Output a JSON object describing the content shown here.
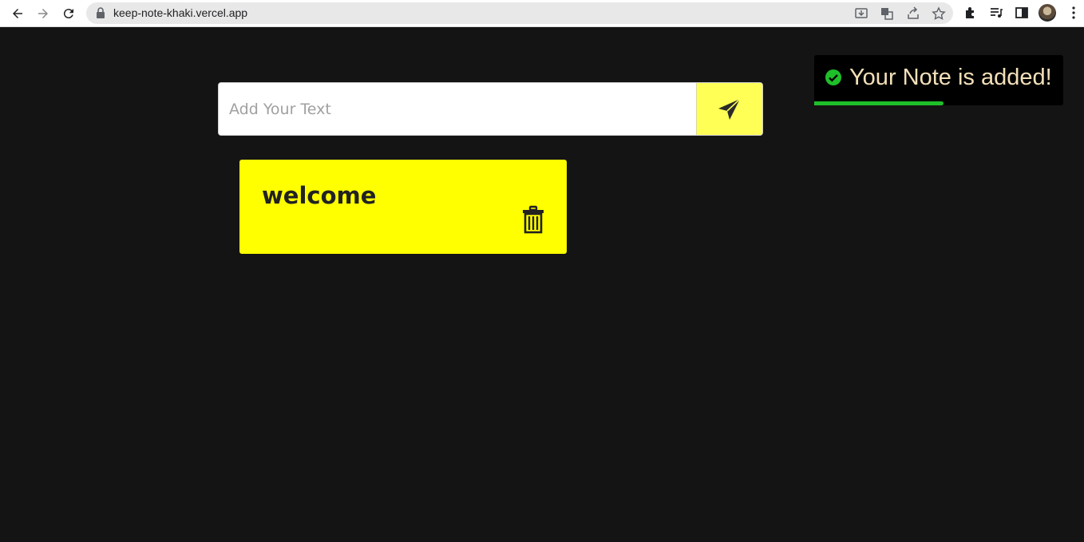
{
  "browser": {
    "url": "keep-note-khaki.vercel.app"
  },
  "composer": {
    "placeholder": "Add Your Text",
    "value": ""
  },
  "notes": [
    {
      "text": "welcome"
    }
  ],
  "toast": {
    "message": "Your Note is added!",
    "status": "success",
    "progress_fraction": 0.52
  },
  "colors": {
    "background": "#141414",
    "note": "#ffff00",
    "send_button": "#ffff55",
    "toast_text": "#f3e0b9",
    "success": "#1fbf2a"
  }
}
